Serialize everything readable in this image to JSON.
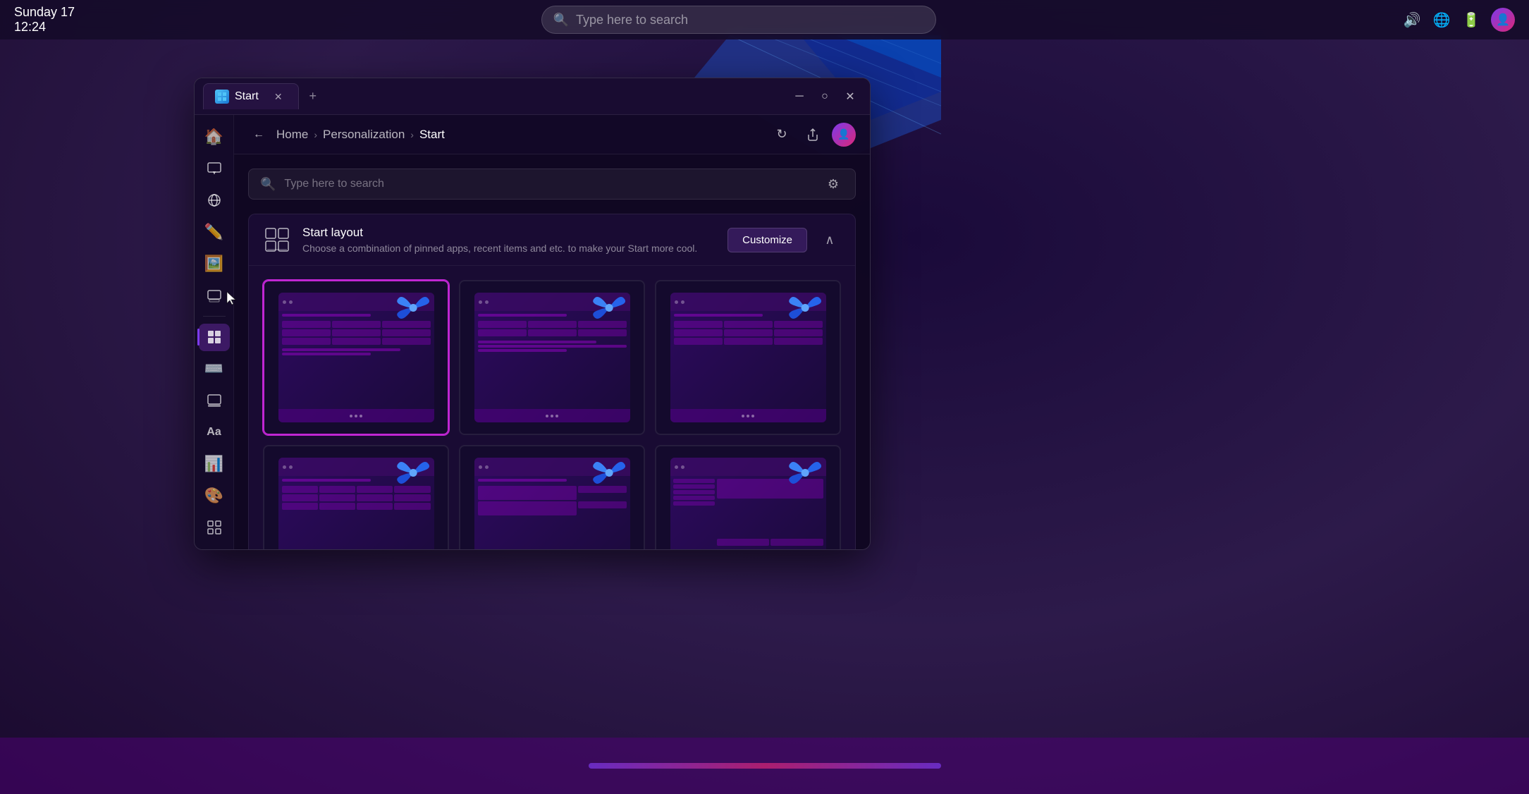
{
  "taskbar": {
    "day": "Sunday 17",
    "time": "12:24",
    "search_placeholder": "Type here to search"
  },
  "window": {
    "title": "Start",
    "tab_label": "Start",
    "breadcrumb": {
      "home": "Home",
      "personalization": "Personalization",
      "current": "Start"
    }
  },
  "content": {
    "search_placeholder": "Type here to search",
    "section": {
      "title": "Start layout",
      "description": "Choose a combination of pinned apps, recent items and etc. to make your Start more cool.",
      "customize_label": "Customize"
    },
    "layout_items": [
      {
        "id": 1,
        "selected": true
      },
      {
        "id": 2,
        "selected": false
      },
      {
        "id": 3,
        "selected": false
      },
      {
        "id": 4,
        "selected": false
      },
      {
        "id": 5,
        "selected": false
      },
      {
        "id": 6,
        "selected": false
      }
    ]
  },
  "sidebar": {
    "items": [
      {
        "name": "home",
        "icon": "🏠",
        "active": false
      },
      {
        "name": "display",
        "icon": "🖥",
        "active": false
      },
      {
        "name": "network",
        "icon": "🌐",
        "active": false
      },
      {
        "name": "paint",
        "icon": "✏️",
        "active": false
      },
      {
        "name": "photos",
        "icon": "🖼",
        "active": false
      },
      {
        "name": "remote",
        "icon": "🖥",
        "active": false
      },
      {
        "name": "start-settings",
        "icon": "⊞",
        "active": true
      },
      {
        "name": "keyboard",
        "icon": "⌨",
        "active": false
      },
      {
        "name": "taskbar",
        "icon": "🖥",
        "active": false
      },
      {
        "name": "fonts",
        "icon": "Aa",
        "active": false
      },
      {
        "name": "chart",
        "icon": "📊",
        "active": false
      },
      {
        "name": "collab",
        "icon": "🎨",
        "active": false
      },
      {
        "name": "apps",
        "icon": "⊞",
        "active": false
      }
    ]
  }
}
